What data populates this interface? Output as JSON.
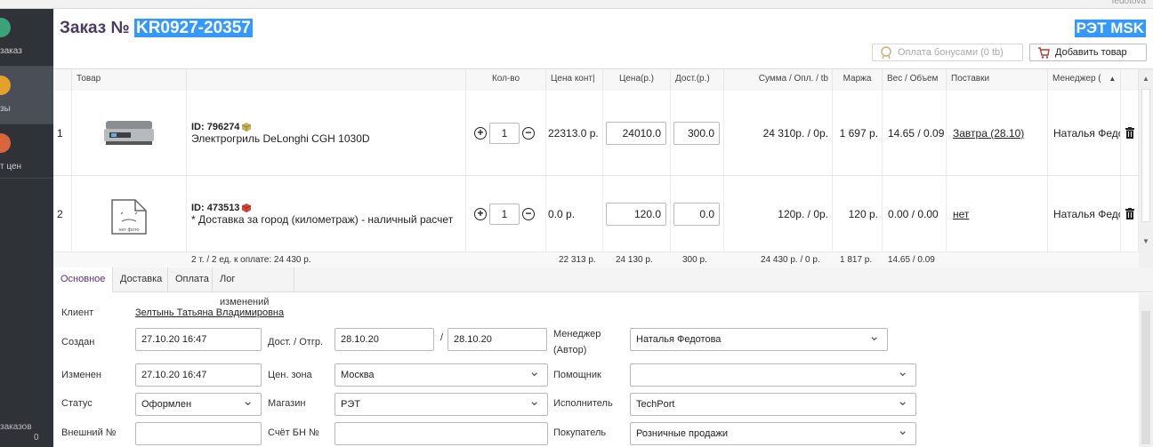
{
  "top": {
    "user": "fedotova"
  },
  "sidebar": {
    "items": [
      {
        "label": "заказ",
        "color": "#3aa37a"
      },
      {
        "label": "зы",
        "color": "#e2a12b"
      },
      {
        "label": "т цен",
        "color": "#d9663a"
      }
    ],
    "bottom_label": "заказов",
    "bottom_count": "0"
  },
  "header": {
    "title_prefix": "Заказ №",
    "order_number": "KR0927-20357",
    "store": "РЭТ MSK",
    "bonus_button": "Оплата бонусами (0 tb)",
    "add_button": "Добавить товар"
  },
  "grid": {
    "columns": {
      "product": "Товар",
      "qty": "Кол-во",
      "contract_price": "Цена конт|",
      "price": "Цена(р.)",
      "delivery": "Дост.(р.)",
      "sum": "Сумма / Опл. / tb",
      "margin": "Маржа",
      "weight": "Вес / Объем",
      "supplies": "Поставки",
      "manager": "Менеджер ("
    },
    "rows": [
      {
        "n": "1",
        "image": "electric-grill",
        "id": "ID: 796274",
        "name": "Электрогриль DeLonghi CGH 1030D",
        "qty": "1",
        "contract_price": "22313.0 р.",
        "price": "24010.0",
        "delivery": "300.0",
        "sum": "24 310р. / 0р.",
        "margin": "1 697 р.",
        "weight": "14.65 / 0.09",
        "supplies": "Завтра (28.10)",
        "manager": "Наталья Федо"
      },
      {
        "n": "2",
        "image": "no-photo",
        "id": "ID: 473513",
        "name": "* Доставка за город (километраж) - наличный расчет",
        "qty": "1",
        "contract_price": "0.0 р.",
        "price": "120.0",
        "delivery": "0.0",
        "sum": "120р. / 0р.",
        "margin": "120 р.",
        "weight": "0.00 / 0.00",
        "supplies": "нет",
        "manager": "Наталья Федо"
      }
    ],
    "no_photo_text": "нет фото",
    "totals": {
      "items": "2 т. / 2 ед. к оплате: 24 430 р.",
      "contract": "22 313 р.",
      "price": "24 130 р.",
      "delivery": "300 р.",
      "sum": "24 430 р. / 0 р.",
      "margin": "1 817 р.",
      "weight": "14.65 / 0.09"
    }
  },
  "tabs": [
    "Основное",
    "Доставка",
    "Оплата",
    "Лог изменений"
  ],
  "form": {
    "client_label": "Клиент",
    "client_value": "Зелтынь Татьяна Владимировна",
    "created_label": "Создан",
    "created_value": "27.10.20 16:47",
    "ship_label": "Дост. / Отгр.",
    "ship_from": "28.10.20",
    "ship_sep": "/",
    "ship_to": "28.10.20",
    "manager_label_1": "Менеджер",
    "manager_label_2": "(Автор)",
    "manager_value": "Наталья Федотова",
    "changed_label": "Изменен",
    "changed_value": "27.10.20 16:47",
    "zone_label": "Цен. зона",
    "zone_value": "Москва",
    "helper_label": "Помощник",
    "helper_value": "",
    "status_label": "Статус",
    "status_value": "Оформлен",
    "shop_label": "Магазин",
    "shop_value": "РЭТ",
    "executor_label": "Исполнитель",
    "executor_value": "TechPort",
    "external_label": "Внешний №",
    "external_value": "",
    "check_label": "Счёт БН №",
    "check_value": "",
    "buyer_label": "Покупатель",
    "buyer_value": "Розничные продажи"
  }
}
